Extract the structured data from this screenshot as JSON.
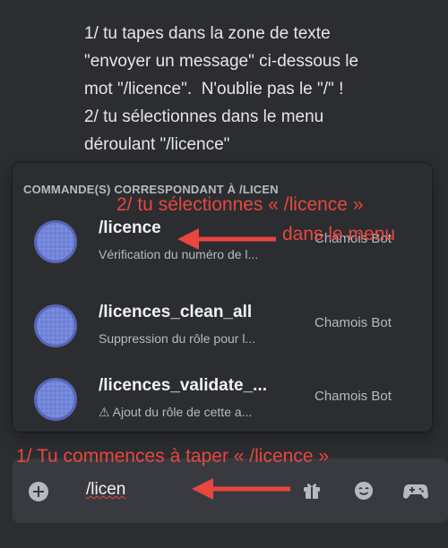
{
  "instructions": {
    "line1": "1/ tu tapes dans la zone de texte",
    "line2": "\"envoyer un message\" ci-dessous le",
    "line3": "mot \"/licence\".  N'oublie pas le \"/\" !",
    "line4": "2/ tu sélectionnes dans le menu",
    "line5": "déroulant \"/licence\""
  },
  "popup": {
    "header": "COMMANDE(S) CORRESPONDANT À /LICEN",
    "commands": [
      {
        "name": "/licence",
        "description": "Vérification du numéro de l...",
        "bot": "Chamois Bot"
      },
      {
        "name": "/licences_clean_all",
        "description": "Suppression du rôle pour l...",
        "bot": "Chamois Bot"
      },
      {
        "name": "/licences_validate_...",
        "description": "⚠ Ajout du rôle de cette a...",
        "bot": "Chamois Bot"
      }
    ]
  },
  "annotations": {
    "select_line1": "2/ tu sélectionnes « /licence »",
    "select_line2": "dans le menu",
    "type_hint": "1/ Tu commences à taper « /licence »"
  },
  "composer": {
    "typed_text": "/licen",
    "icons": [
      "plus-circle-icon",
      "gift-icon",
      "emoji-icon",
      "gamepad-icon"
    ]
  },
  "colors": {
    "annotation": "#e8473d",
    "background": "#2b2d31",
    "composer": "#383a40",
    "avatar": "#6b7fd7"
  }
}
